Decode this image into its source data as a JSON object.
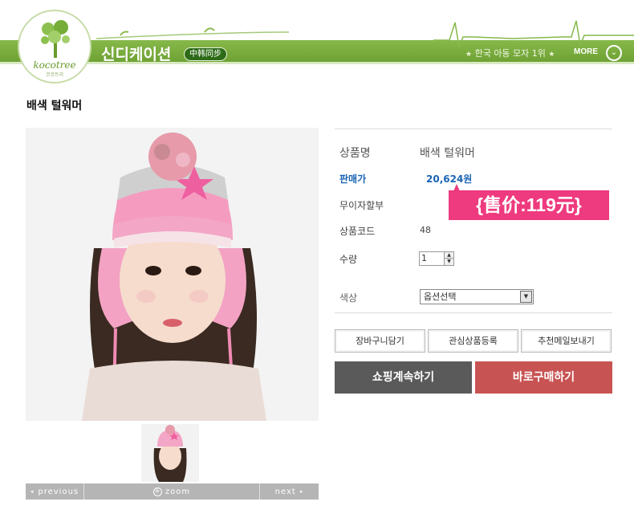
{
  "header": {
    "logo_text": "kocotree",
    "logo_sub": "코코트리",
    "brand_title": "신디케이션",
    "brand_badge": "中韩同步",
    "right_text": "한국 아동 모자 1위",
    "more_label": "MORE"
  },
  "product": {
    "page_title": "배색 털워머",
    "labels": {
      "name": "상품명",
      "price": "판매가",
      "interest_free": "무이자할부",
      "code": "상품코드",
      "quantity": "수량",
      "color": "색상"
    },
    "values": {
      "name": "배색 털워머",
      "price": "20,624원",
      "code": "48",
      "quantity": "1",
      "color_selected": "옵션선택"
    },
    "promo_sticker": "{售价:119元}"
  },
  "gallery": {
    "prev_label": "previous",
    "zoom_label": "zoom",
    "next_label": "next"
  },
  "buttons": {
    "cart": "장바구니담기",
    "wishlist": "관심상품등록",
    "recommend": "추천메일보내기",
    "continue_shopping": "쇼핑계속하기",
    "buy_now": "바로구매하기"
  },
  "colors": {
    "header_green": "#7bb03f",
    "buy_red": "#c85353",
    "continue_gray": "#5a5a5a",
    "price_blue": "#1a64b4",
    "promo_pink": "#ee3a7e"
  }
}
